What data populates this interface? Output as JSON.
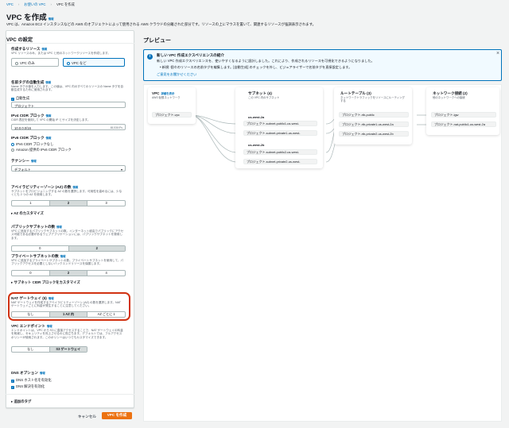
{
  "breadcrumbs": [
    "VPC",
    "お使いの VPC",
    "VPC を作成"
  ],
  "page": {
    "title": "VPC を作成",
    "info": "情報",
    "description": "VPC は、Amazon EC2 インスタンスなどの AWS のオブジェクトによって使用される AWS クラウドの分離された部分です。リソースの上にマウスを置いて、関連するリソースが強調表示されます。"
  },
  "settings": {
    "heading": "VPC の設定",
    "resources": {
      "label": "作成するリソース",
      "info": "情報",
      "desc": "VPC リソースのみ、または VPC と他のネットワークリソースを作成します。",
      "opt_vpc_only": "VPC のみ",
      "opt_vpc_more": "VPC など"
    },
    "nametag": {
      "label": "名前タグの自動生成",
      "info": "情報",
      "desc": "Name タグの値を入力します。この値は、VPC 内のすべてのリソースの Name タグを自動生成するために使用されます。",
      "checkbox": "自動生成",
      "value": "プロジェクト"
    },
    "ipv4": {
      "label": "IPv4 CIDR ブロック",
      "info": "情報",
      "desc": "CIDR 表記を使用して VPC の開始 IP とサイズを決定します。",
      "value": "10.0.0.0/16",
      "count": "65,536 IPs"
    },
    "ipv6": {
      "label": "IPv6 CIDR ブロック",
      "info": "情報",
      "opt_none": "IPv6 CIDR ブロックなし",
      "opt_amazon": "Amazon 提供の IPv6 CIDR ブロック"
    },
    "tenancy": {
      "label": "テナンシー",
      "info": "情報",
      "value": "デフォルト"
    },
    "az": {
      "label": "アベイラビリティーゾーン (AZ) の数",
      "info": "情報",
      "desc": "サブネットをプロビジョニングする AZ の数を選択します。可用性を高めるには、少なくとも 2 つの AZ を使用します。",
      "options": [
        "1",
        "2",
        "3"
      ],
      "customize": "AZ のカスタマイズ"
    },
    "public": {
      "label": "パブリックサブネットの数",
      "info": "情報",
      "desc": "VPC に追加するパブリックサブネットの数。インターネット経由でパブリックにアクセス可能である必要があるウェブアプリケーションには、パブリックサブネットを使用します。",
      "options": [
        "0",
        "2"
      ]
    },
    "private": {
      "label": "プライベートサブネットの数",
      "info": "情報",
      "desc": "VPC に追加するプライベートサブネットの数。プライベートサブネットを使用して、パブリックアクセスを必要としないバックエンドリソースを保護します。",
      "options": [
        "0",
        "2",
        "4"
      ],
      "customize": "サブネット CIDR ブロックをカスタマイズ"
    },
    "nat": {
      "label": "NAT ゲートウェイ ($)",
      "info": "情報",
      "desc": "NAT ゲートウェイを作成するアベイラビリティーゾーン (AZ) の数を選択します。NAT ゲートウェイごとに料金が発生することに注意してください。",
      "options": [
        "なし",
        "1 AZ 内",
        "AZ ごとに 1"
      ]
    },
    "endpoint": {
      "label": "VPC エンドポイント",
      "info": "情報",
      "desc": "エンドポイントは、VPC から S3 に直接アクセスすることで、NAT ゲートウェイの料金を削減し、セキュリティを向上させるのに役立ちます。デフォルトでは、フルアクセスポリシーが使用されます。このポリシーはいつでもカスタマイズできます。",
      "options": [
        "なし",
        "S3 ゲートウェイ"
      ]
    },
    "dns": {
      "label": "DNS オプション",
      "info": "情報",
      "hostnames": "DNS ホスト名を有効化",
      "resolution": "DNS 解決を有効化"
    },
    "tags": "追加のタグ",
    "cancel": "キャンセル",
    "create": "VPC を作成"
  },
  "preview": {
    "heading": "プレビュー",
    "alert": {
      "title": "新しい VPC 作成エクスペリエンスの紹介",
      "body": "新しい VPC 作成エクスペリエンスを、使いやすくなるように設計しました。これにより、作成されるリソースを可視化できるようになりました。",
      "bullet": "新規: 個々のリソースの名前タグを編集します。[自動生成] のチェックを外し、ビジュアライザーで名前タグを直接設定します。",
      "link": "ご意見をお聞かせください",
      "close": "×"
    },
    "vpc": {
      "title": "VPC",
      "info": "詳細を表示",
      "sub": "AWS 仮想ネットワーク",
      "node": "プロジェクト-vpc"
    },
    "subnets": {
      "title": "サブネット (4)",
      "sub": "この VPC 内のサブネット",
      "groups": [
        {
          "az": "us-west-2a",
          "items": [
            "プロジェクト-subnet-public1-us-west-",
            "プロジェクト-subnet-private1-us-west-"
          ]
        },
        {
          "az": "us-west-2b",
          "items": [
            "プロジェクト-subnet-public2-us-west-",
            "プロジェクト-subnet-private2-us-west-"
          ]
        }
      ]
    },
    "routes": {
      "title": "ルートテーブル (3)",
      "sub": "ネットワークトラフィックをリソースにルーティングする",
      "items": [
        "プロジェクト-rtb-public",
        "プロジェクト-rtb-private1-us-west-2a",
        "プロジェクト-rtb-private2-us-west-2b"
      ]
    },
    "connections": {
      "title": "ネットワーク接続 (2)",
      "sub": "他のネットワークへの接続",
      "items": [
        "プロジェクト-igw",
        "プロジェクト-nat-public1-us-west-2a"
      ]
    }
  }
}
